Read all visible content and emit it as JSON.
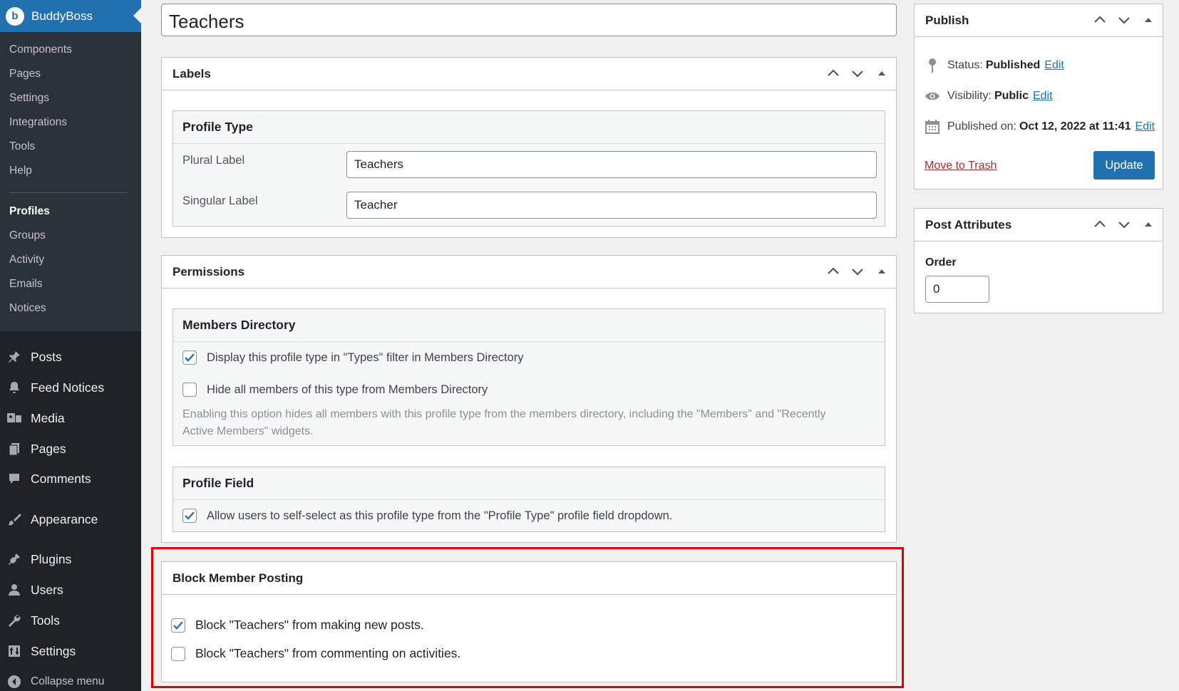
{
  "sidebar": {
    "brand": "BuddyBoss",
    "brand_logo_text": "b",
    "submenu": [
      "Components",
      "Pages",
      "Settings",
      "Integrations",
      "Tools",
      "Help"
    ],
    "submenu_section2": [
      "Profiles",
      "Groups",
      "Activity",
      "Emails",
      "Notices"
    ],
    "menu": [
      {
        "label": "Posts",
        "icon": "pin-icon"
      },
      {
        "label": "Feed Notices",
        "icon": "bell-icon"
      },
      {
        "label": "Media",
        "icon": "media-icon"
      },
      {
        "label": "Pages",
        "icon": "page-icon"
      },
      {
        "label": "Comments",
        "icon": "comment-icon"
      },
      {
        "label": "Appearance",
        "icon": "brush-icon"
      },
      {
        "label": "Plugins",
        "icon": "plug-icon"
      },
      {
        "label": "Users",
        "icon": "user-icon"
      },
      {
        "label": "Tools",
        "icon": "wrench-icon"
      },
      {
        "label": "Settings",
        "icon": "settings-icon"
      },
      {
        "label": "Collapse menu",
        "icon": "collapse-icon"
      }
    ]
  },
  "post_title": "Teachers",
  "labels_box": {
    "title": "Labels",
    "inner_title": "Profile Type",
    "plural_label": "Plural Label",
    "plural_value": "Teachers",
    "singular_label": "Singular Label",
    "singular_value": "Teacher"
  },
  "permissions_box": {
    "title": "Permissions",
    "members_directory": {
      "title": "Members Directory",
      "option1": "Display this profile type in \"Types\" filter in Members Directory",
      "option1_checked": true,
      "option2": "Hide all members of this type from Members Directory",
      "option2_checked": false,
      "description_line1": "Enabling this option hides all members with this profile type from the members directory, including the \"Members\" and \"Recently",
      "description_line2": "Active Members\" widgets."
    },
    "profile_field": {
      "title": "Profile Field",
      "option1": "Allow users to self-select as this profile type from the \"Profile Type\" profile field dropdown.",
      "option1_checked": true
    }
  },
  "block_box": {
    "title": "Block Member Posting",
    "option1": "Block \"Teachers\" from making new posts.",
    "option1_checked": true,
    "option2": "Block \"Teachers\" from commenting on activities.",
    "option2_checked": false
  },
  "publish_box": {
    "title": "Publish",
    "status_label": "Status:",
    "status_value": "Published",
    "visibility_label": "Visibility:",
    "visibility_value": "Public",
    "published_label": "Published on:",
    "published_value": "Oct 12, 2022 at 11:41",
    "edit": "Edit",
    "trash": "Move to Trash",
    "update": "Update"
  },
  "attributes_box": {
    "title": "Post Attributes",
    "order_label": "Order",
    "order_value": "0"
  },
  "colors": {
    "accent": "#2271b1",
    "sidebar": "#1d2327",
    "highlight": "#e00000",
    "trash": "#b32d2e"
  }
}
